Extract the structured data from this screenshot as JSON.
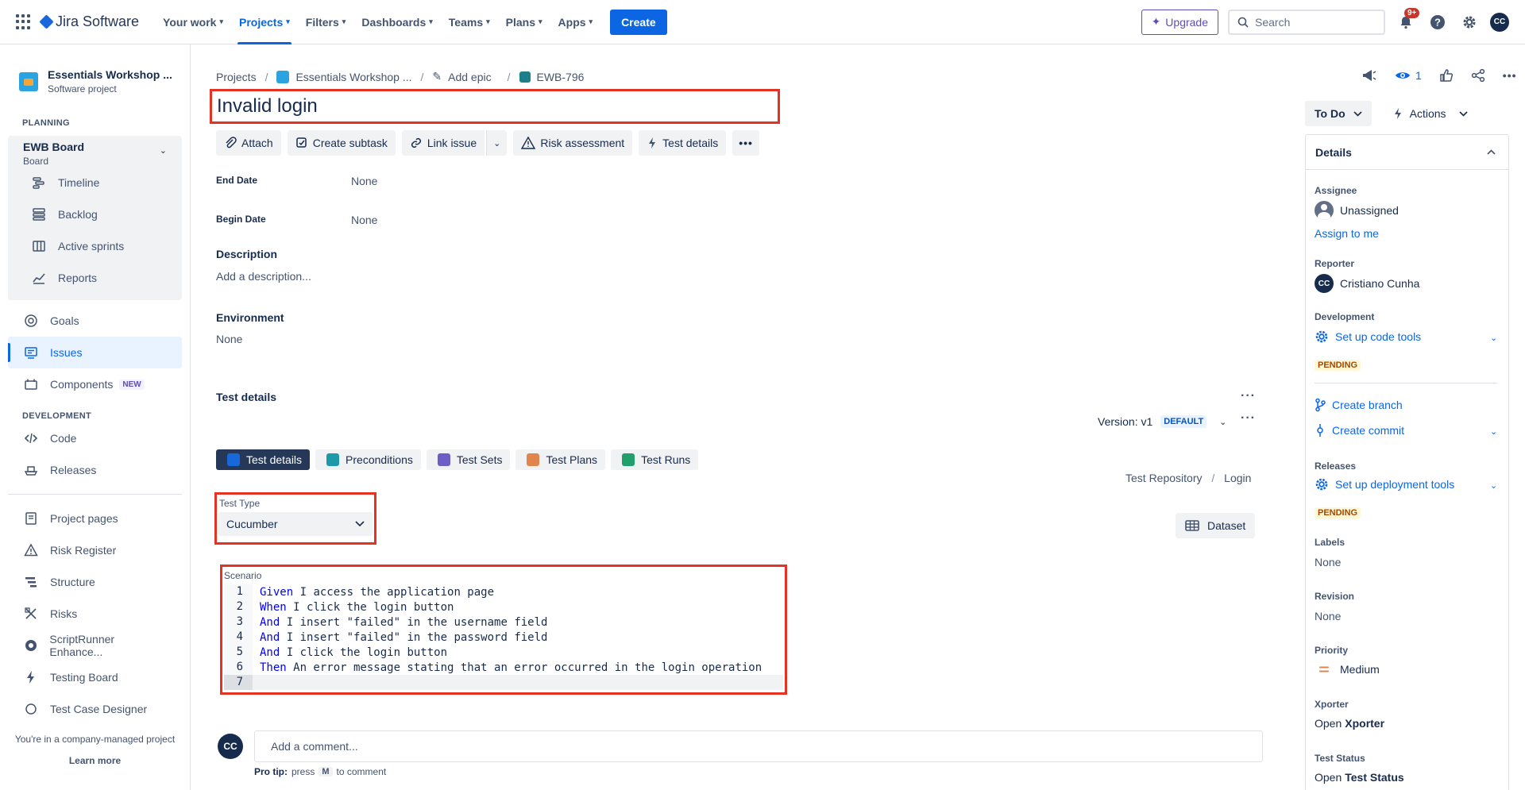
{
  "topnav": {
    "logo_text": "Jira Software",
    "items": [
      {
        "label": "Your work",
        "active": false
      },
      {
        "label": "Projects",
        "active": true
      },
      {
        "label": "Filters",
        "active": false
      },
      {
        "label": "Dashboards",
        "active": false
      },
      {
        "label": "Teams",
        "active": false
      },
      {
        "label": "Plans",
        "active": false
      },
      {
        "label": "Apps",
        "active": false
      }
    ],
    "create_label": "Create",
    "upgrade_label": "Upgrade",
    "search_placeholder": "Search",
    "notifications_badge": "9+",
    "user_initials": "CC"
  },
  "sidebar": {
    "project_name": "Essentials Workshop ...",
    "project_type": "Software project",
    "planning_heading": "PLANNING",
    "board_title": "EWB Board",
    "board_sub": "Board",
    "planning_items": [
      {
        "label": "Timeline",
        "icon": "timeline-icon"
      },
      {
        "label": "Backlog",
        "icon": "backlog-icon"
      },
      {
        "label": "Active sprints",
        "icon": "board-icon"
      },
      {
        "label": "Reports",
        "icon": "reports-icon"
      }
    ],
    "goals_label": "Goals",
    "issues_label": "Issues",
    "components_label": "Components",
    "new_label": "NEW",
    "development_heading": "DEVELOPMENT",
    "code_label": "Code",
    "releases_label": "Releases",
    "extra_items": [
      {
        "label": "Project pages"
      },
      {
        "label": "Risk Register"
      },
      {
        "label": "Structure"
      },
      {
        "label": "Risks"
      },
      {
        "label": "ScriptRunner Enhance..."
      },
      {
        "label": "Testing Board"
      },
      {
        "label": "Test Case Designer"
      }
    ],
    "footer_text": "You're in a company-managed project",
    "footer_link": "Learn more"
  },
  "breadcrumb": {
    "projects": "Projects",
    "project": "Essentials Workshop ...",
    "epic": "Add epic",
    "issue_key": "EWB-796"
  },
  "issue": {
    "title": "Invalid login",
    "toolbar": {
      "attach": "Attach",
      "create_subtask": "Create subtask",
      "link_issue": "Link issue",
      "risk_assessment": "Risk assessment",
      "test_details": "Test details"
    },
    "end_date_label": "End Date",
    "end_date_value": "None",
    "begin_date_label": "Begin Date",
    "begin_date_value": "None",
    "description_label": "Description",
    "description_placeholder": "Add a description...",
    "environment_label": "Environment",
    "environment_value": "None"
  },
  "test_details": {
    "heading": "Test details",
    "version_label": "Version: v1",
    "default_label": "DEFAULT",
    "tabs": [
      {
        "label": "Test details",
        "active": true,
        "color": "#1868db"
      },
      {
        "label": "Preconditions",
        "active": false,
        "color": "#1d9aaa"
      },
      {
        "label": "Test Sets",
        "active": false,
        "color": "#6e5dc6"
      },
      {
        "label": "Test Plans",
        "active": false,
        "color": "#e2844e"
      },
      {
        "label": "Test Runs",
        "active": false,
        "color": "#22a06b"
      }
    ],
    "repo_path": "Test Repository",
    "repo_folder": "Login",
    "test_type_label": "Test Type",
    "test_type_value": "Cucumber",
    "dataset_label": "Dataset",
    "scenario_label": "Scenario",
    "scenario_lines": [
      {
        "n": "1",
        "kw": "Given",
        "parts": [
          {
            "t": " I access the application page",
            "s": false
          }
        ]
      },
      {
        "n": "2",
        "kw": "When",
        "parts": [
          {
            "t": " I click the login button",
            "s": false
          }
        ]
      },
      {
        "n": "3",
        "kw": "And",
        "parts": [
          {
            "t": " I insert ",
            "s": false
          },
          {
            "t": "\"failed\"",
            "s": true
          },
          {
            "t": " in the username field",
            "s": false
          }
        ]
      },
      {
        "n": "4",
        "kw": "And",
        "parts": [
          {
            "t": " I insert ",
            "s": false
          },
          {
            "t": "\"failed\"",
            "s": true
          },
          {
            "t": " in the password field",
            "s": false
          }
        ]
      },
      {
        "n": "5",
        "kw": "And",
        "parts": [
          {
            "t": " I click the login button",
            "s": false
          }
        ]
      },
      {
        "n": "6",
        "kw": "Then",
        "parts": [
          {
            "t": " An error message stating that an error occurred in the login operation",
            "s": false
          }
        ]
      },
      {
        "n": "7",
        "kw": "",
        "parts": []
      }
    ]
  },
  "comment": {
    "avatar": "CC",
    "placeholder": "Add a comment...",
    "protip_prefix": "Pro tip:",
    "protip_press": "press",
    "protip_key": "M",
    "protip_suffix": "to comment"
  },
  "right": {
    "watch_count": "1",
    "status_label": "To Do",
    "actions_label": "Actions",
    "details_heading": "Details",
    "assignee_label": "Assignee",
    "assignee_value": "Unassigned",
    "assign_to_me": "Assign to me",
    "reporter_label": "Reporter",
    "reporter_initials": "CC",
    "reporter_value": "Cristiano Cunha",
    "development_label": "Development",
    "setup_code_tools": "Set up code tools",
    "pending_label": "PENDING",
    "create_branch": "Create branch",
    "create_commit": "Create commit",
    "releases_label": "Releases",
    "setup_deploy_tools": "Set up deployment tools",
    "labels_label": "Labels",
    "labels_value": "None",
    "revision_label": "Revision",
    "revision_value": "None",
    "priority_label": "Priority",
    "priority_value": "Medium",
    "xporter_label": "Xporter",
    "xporter_prefix": "Open",
    "xporter_value": "Xporter",
    "test_status_label": "Test Status",
    "test_status_prefix": "Open",
    "test_status_value": "Test Status"
  }
}
